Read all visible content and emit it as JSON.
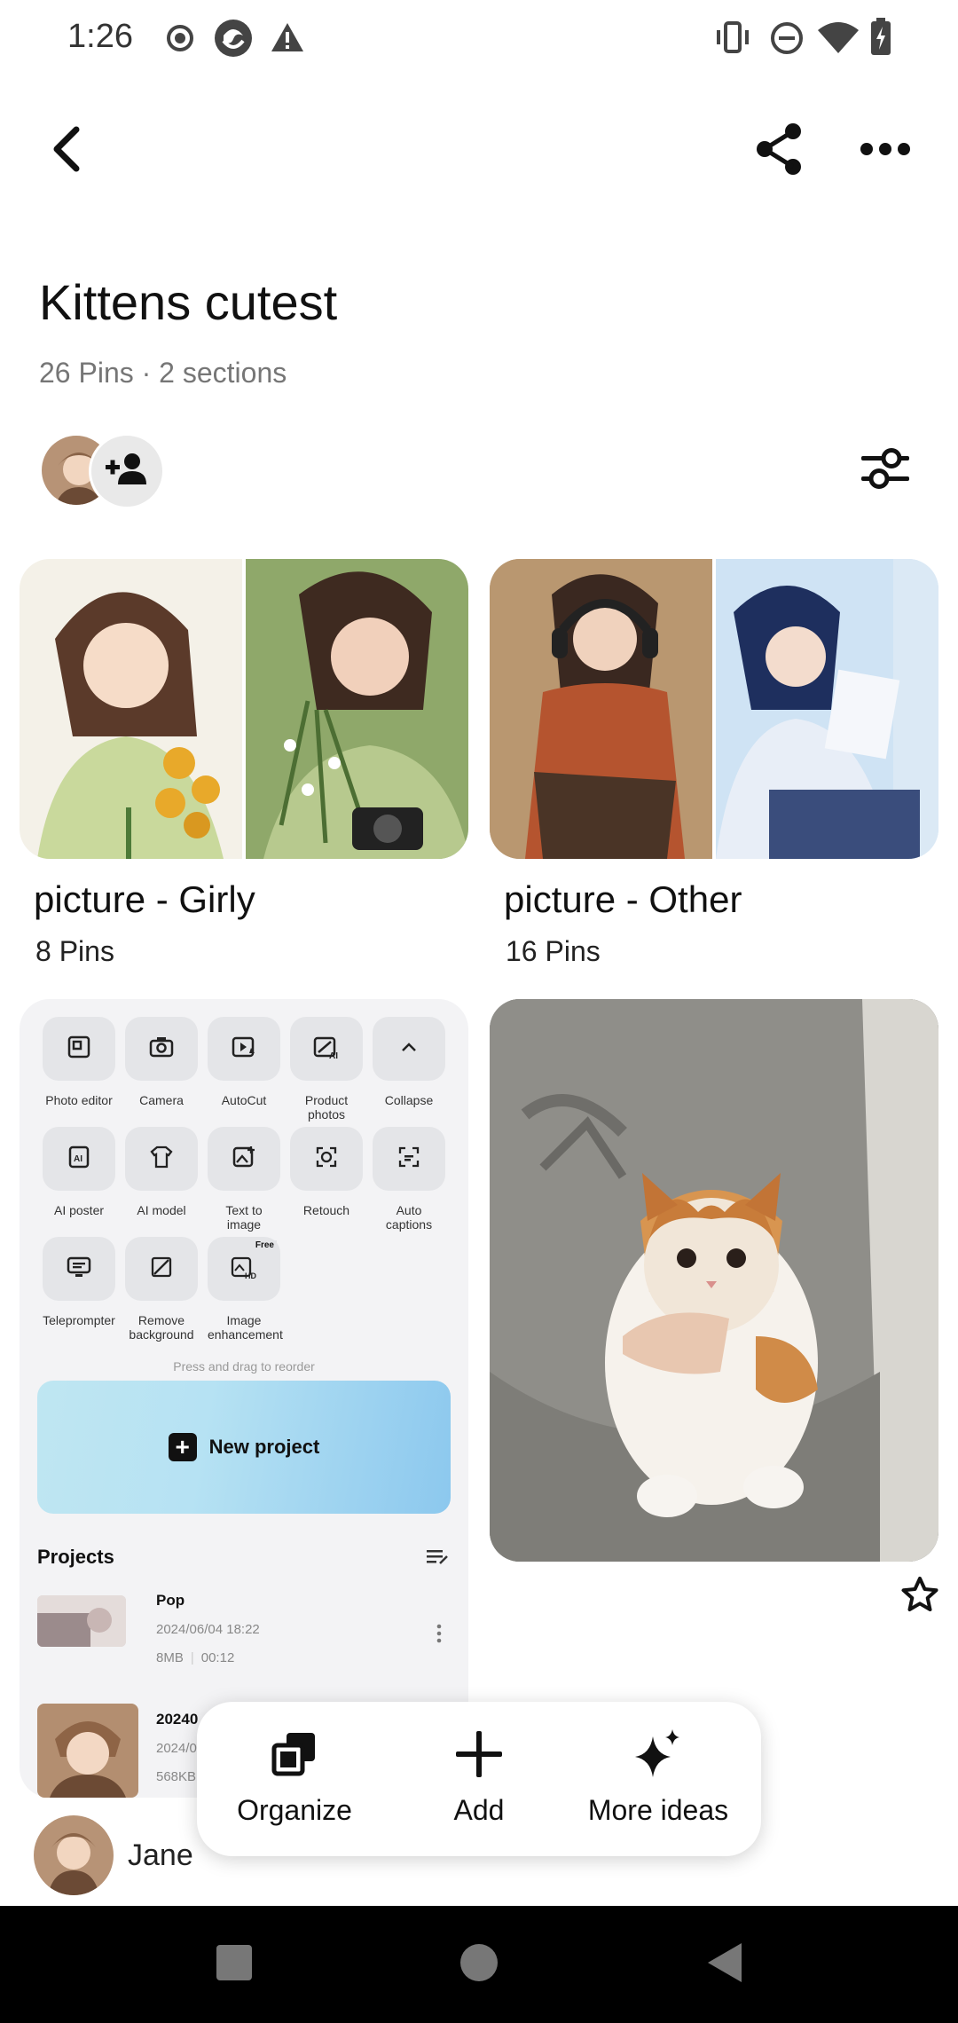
{
  "status_bar": {
    "time": "1:26",
    "left_icons": [
      "record-icon",
      "app-icon",
      "warning-icon"
    ],
    "right_icons": [
      "vibrate-icon",
      "do-not-disturb-icon",
      "wifi-icon",
      "battery-charging-icon"
    ]
  },
  "header": {
    "back_icon": "chevron-left-icon",
    "share_icon": "share-icon",
    "more_icon": "more-horizontal-icon"
  },
  "board": {
    "title": "Kittens cutest",
    "meta": "26 Pins · 2 sections"
  },
  "sections": [
    {
      "name": "picture - Girly",
      "count": "8 Pins"
    },
    {
      "name": "picture - Other",
      "count": "16 Pins"
    }
  ],
  "screenshot_pin": {
    "tools": [
      {
        "label": "Photo editor",
        "icon": "photo-edit-icon"
      },
      {
        "label": "Camera",
        "icon": "camera-icon"
      },
      {
        "label": "AutoCut",
        "icon": "autocut-icon"
      },
      {
        "label": "Product photos",
        "icon": "product-photo-icon"
      },
      {
        "label": "Collapse",
        "icon": "chevron-up-icon"
      },
      {
        "label": "AI poster",
        "icon": "ai-poster-icon"
      },
      {
        "label": "AI model",
        "icon": "ai-model-icon"
      },
      {
        "label": "Text to image",
        "icon": "text-image-icon"
      },
      {
        "label": "Retouch",
        "icon": "retouch-icon"
      },
      {
        "label": "Auto captions",
        "icon": "captions-icon"
      },
      {
        "label": "Teleprompter",
        "icon": "teleprompter-icon"
      },
      {
        "label": "Remove background",
        "icon": "remove-bg-icon"
      },
      {
        "label": "Image enhancement",
        "icon": "hd-icon",
        "badge": "Free"
      }
    ],
    "press_hint": "Press and drag to reorder",
    "new_project": "New project",
    "projects_title": "Projects",
    "projects": [
      {
        "name": "Pop",
        "date": "2024/06/04 18:22",
        "size": "8MB",
        "duration": "00:12"
      },
      {
        "name": "20240",
        "date": "2024/0",
        "size": "568KB"
      }
    ]
  },
  "creator": {
    "name": "Jane"
  },
  "actions": [
    {
      "label": "Organize",
      "icon": "organize-icon"
    },
    {
      "label": "Add",
      "icon": "plus-icon"
    },
    {
      "label": "More ideas",
      "icon": "sparkle-icon"
    }
  ],
  "nav": [
    "recents-square-icon",
    "home-circle-icon",
    "back-triangle-icon"
  ],
  "colors": {
    "accent": "#111111",
    "meta_text": "#767676",
    "nav_bg": "#000000"
  }
}
